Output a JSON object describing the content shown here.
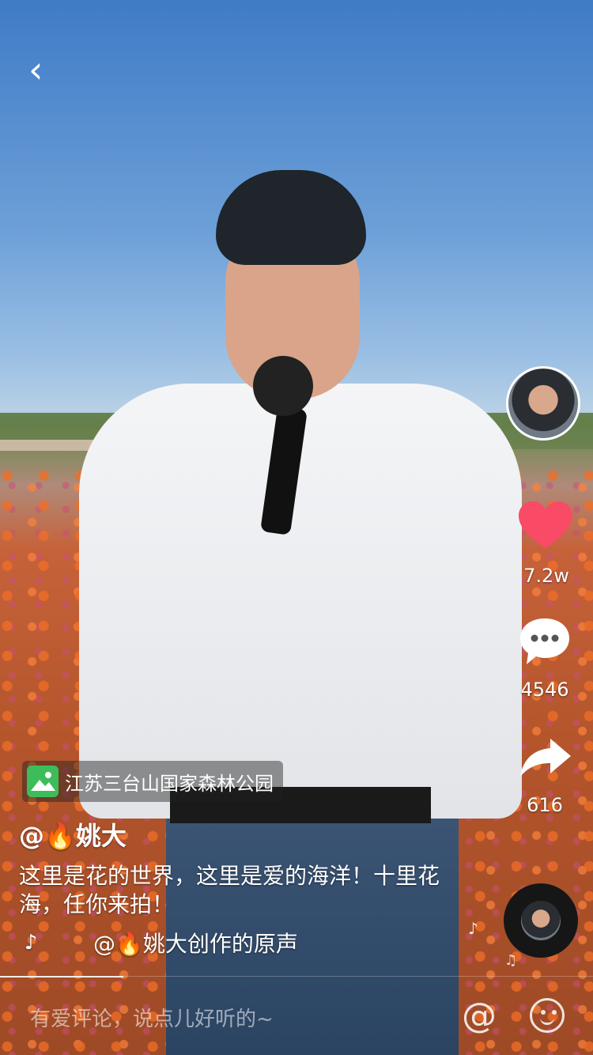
{
  "nav": {
    "back_icon": "chevron-left-icon",
    "back_glyph": "‹"
  },
  "location": {
    "icon": "landscape-icon",
    "name": "江苏三台山国家森林公园"
  },
  "author": {
    "handle": "@🔥姚大"
  },
  "caption": "这里是花的世界，这里是爱的海洋！十里花海，任你来拍！",
  "music": {
    "icon": "tiktok-note-icon",
    "icon_glyph": "♪",
    "title": "@🔥姚大创作的原声"
  },
  "actions": {
    "like": {
      "icon": "heart-icon",
      "count": "7.2w",
      "color": "#f94a66"
    },
    "comment": {
      "icon": "comment-bubble-icon",
      "count": "4546"
    },
    "share": {
      "icon": "share-arrow-icon",
      "count": "616"
    }
  },
  "comment_bar": {
    "placeholder": "有爱评论，说点儿好听的~",
    "at_icon": "at-icon",
    "at_glyph": "@",
    "emoji_icon": "smiley-icon"
  },
  "decor": {
    "note_glyph_1": "♪",
    "note_glyph_2": "♫"
  }
}
